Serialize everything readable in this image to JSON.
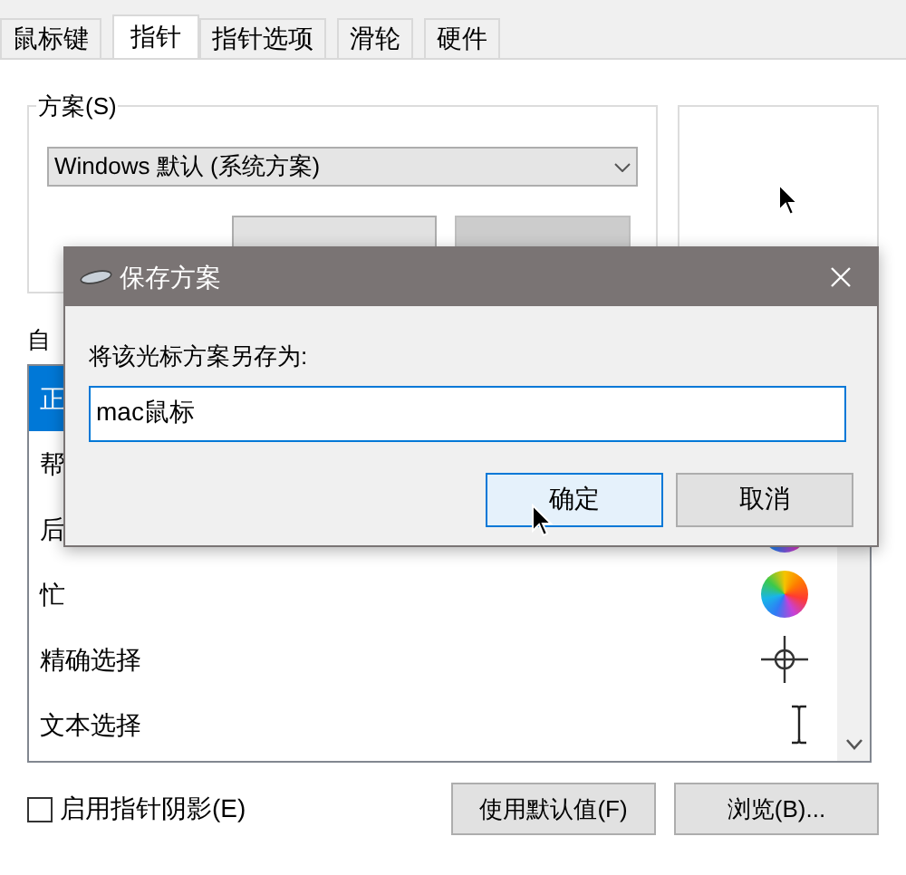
{
  "tabs": [
    {
      "label": "鼠标键",
      "selected": false
    },
    {
      "label": "指针",
      "selected": true
    },
    {
      "label": "指针选项",
      "selected": false
    },
    {
      "label": "滑轮",
      "selected": false
    },
    {
      "label": "硬件",
      "selected": false
    }
  ],
  "scheme": {
    "legend": "方案(S)",
    "value": "Windows 默认 (系统方案)",
    "buttons": [
      {
        "disabled": false
      },
      {
        "disabled": true
      }
    ]
  },
  "customize": {
    "label": "自",
    "items": [
      {
        "label": "正",
        "selected": true
      },
      {
        "label": "帮",
        "selected": false
      },
      {
        "label": "后",
        "selected": false,
        "kind": "busy"
      },
      {
        "label": "忙",
        "selected": false,
        "kind": "busy"
      },
      {
        "label": "精确选择",
        "selected": false,
        "kind": "crosshair"
      },
      {
        "label": "文本选择",
        "selected": false,
        "kind": "ibeam"
      }
    ]
  },
  "shadow_option": {
    "label": "启用指针阴影(E)",
    "checked": false
  },
  "buttons": [
    "使用默认值(F)",
    "浏览(B)..."
  ],
  "dialog": {
    "title": "保存方案",
    "prompt": "将该光标方案另存为:",
    "value": "mac鼠标",
    "buttons": [
      {
        "label": "确定",
        "selected": true
      },
      {
        "label": "取消",
        "selected": false
      }
    ]
  }
}
